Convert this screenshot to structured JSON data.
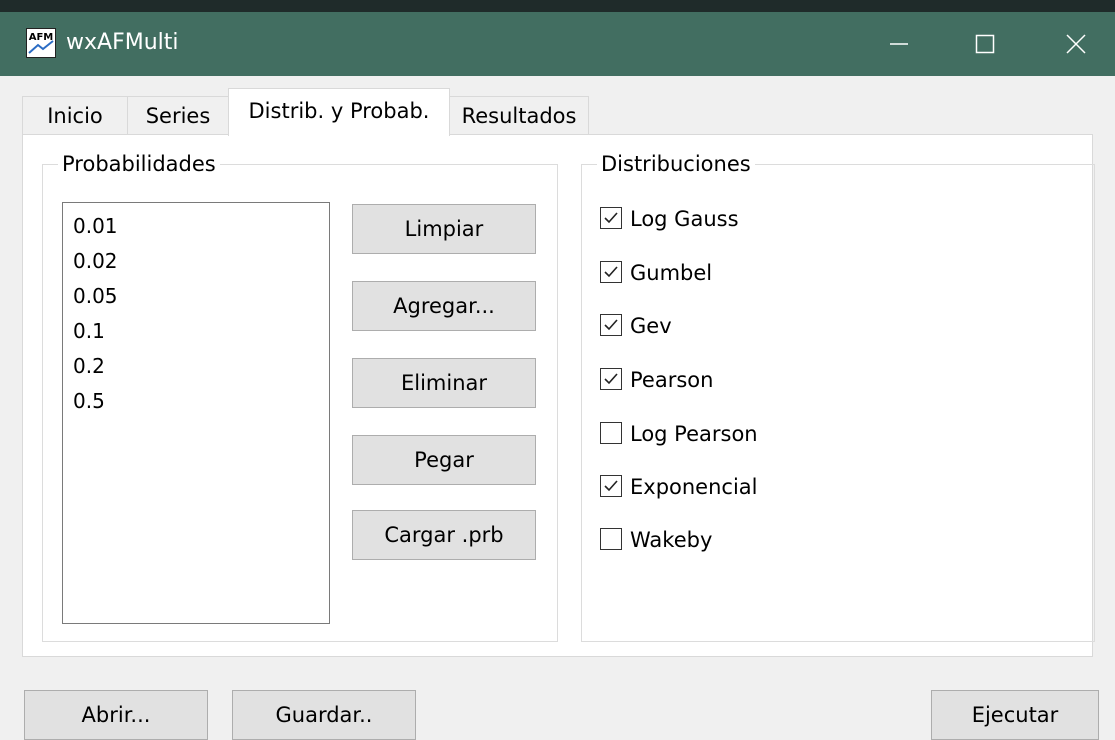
{
  "window": {
    "title": "wxAFMulti",
    "app_icon": "afm-app-icon",
    "controls": [
      "minimize-icon",
      "maximize-icon",
      "close-icon"
    ],
    "titlebar_color": "#426e61"
  },
  "tabs": [
    {
      "label": "Inicio",
      "active": false
    },
    {
      "label": "Series",
      "active": false
    },
    {
      "label": "Distrib. y Probab.",
      "active": true
    },
    {
      "label": "Resultados",
      "active": false
    }
  ],
  "probabilidades": {
    "title": "Probabilidades",
    "values": [
      "0.01",
      "0.02",
      "0.05",
      "0.1",
      "0.2",
      "0.5"
    ],
    "buttons": {
      "limpiar": "Limpiar",
      "agregar": "Agregar...",
      "eliminar": "Eliminar",
      "pegar": "Pegar",
      "cargar": "Cargar .prb"
    }
  },
  "distribuciones": {
    "title": "Distribuciones",
    "items": [
      {
        "label": "Log Gauss",
        "checked": true
      },
      {
        "label": "Gumbel",
        "checked": true
      },
      {
        "label": "Gev",
        "checked": true
      },
      {
        "label": "Pearson",
        "checked": true
      },
      {
        "label": "Log Pearson",
        "checked": false
      },
      {
        "label": "Exponencial",
        "checked": true
      },
      {
        "label": "Wakeby",
        "checked": false
      }
    ]
  },
  "bottom_buttons": {
    "abrir": "Abrir...",
    "guardar": "Guardar..",
    "ejecutar": "Ejecutar"
  }
}
